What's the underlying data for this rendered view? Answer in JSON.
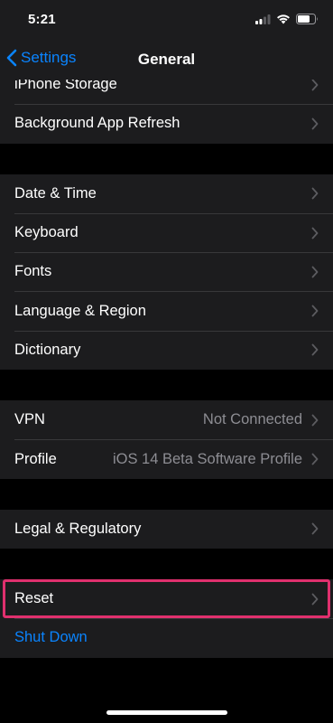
{
  "status_bar": {
    "time": "5:21",
    "icons": [
      "cellular-signal-icon",
      "wifi-icon",
      "battery-icon"
    ]
  },
  "nav": {
    "back_label": "Settings",
    "title": "General"
  },
  "groups": [
    [
      {
        "label": "iPhone Storage"
      },
      {
        "label": "Background App Refresh"
      }
    ],
    [
      {
        "label": "Date & Time"
      },
      {
        "label": "Keyboard"
      },
      {
        "label": "Fonts"
      },
      {
        "label": "Language & Region"
      },
      {
        "label": "Dictionary"
      }
    ],
    [
      {
        "label": "VPN",
        "value": "Not Connected"
      },
      {
        "label": "Profile",
        "value": "iOS 14 Beta Software Profile"
      }
    ],
    [
      {
        "label": "Legal & Regulatory"
      }
    ],
    [
      {
        "label": "Reset",
        "highlighted": true
      },
      {
        "label": "Shut Down"
      }
    ]
  ],
  "colors": {
    "accent": "#0a84ff",
    "highlight": "#e0306e",
    "background": "#000000",
    "cell": "#1c1c1e",
    "secondary_text": "#8d8d93"
  }
}
